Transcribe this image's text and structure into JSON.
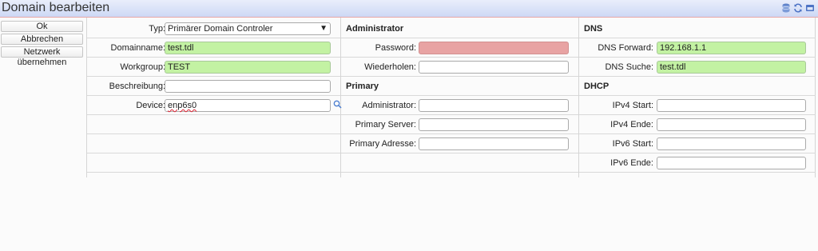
{
  "window": {
    "title": "Domain bearbeiten"
  },
  "toolbar": {
    "buttons": [
      {
        "label": "Ok"
      },
      {
        "label": "Abbrechen"
      },
      {
        "label": "Netzwerk übernehmen"
      }
    ]
  },
  "form": {
    "typ": {
      "label": "Typ:",
      "value": "Primärer Domain Controler"
    },
    "domainname": {
      "label": "Domainname:",
      "value": "test.tdl"
    },
    "workgroup": {
      "label": "Workgroup:",
      "value": "TEST"
    },
    "beschreibung": {
      "label": "Beschreibung:",
      "value": ""
    },
    "device": {
      "label": "Device:",
      "value": "enp6s0"
    }
  },
  "administrator": {
    "heading": "Administrator",
    "password": {
      "label": "Password:",
      "value": ""
    },
    "wiederholen": {
      "label": "Wiederholen:",
      "value": ""
    }
  },
  "primary": {
    "heading": "Primary",
    "administrator": {
      "label": "Administrator:",
      "value": ""
    },
    "server": {
      "label": "Primary Server:",
      "value": ""
    },
    "adresse": {
      "label": "Primary Adresse:",
      "value": ""
    }
  },
  "dns": {
    "heading": "DNS",
    "forward": {
      "label": "DNS Forward:",
      "value": "192.168.1.1"
    },
    "suche": {
      "label": "DNS Suche:",
      "value": "test.tdl"
    }
  },
  "dhcp": {
    "heading": "DHCP",
    "ipv4_start": {
      "label": "IPv4 Start:",
      "value": ""
    },
    "ipv4_ende": {
      "label": "IPv4 Ende:",
      "value": ""
    },
    "ipv6_start": {
      "label": "IPv6 Start:",
      "value": ""
    },
    "ipv6_ende": {
      "label": "IPv6 Ende:",
      "value": ""
    }
  },
  "colors": {
    "valid": "#c3f2a3",
    "invalid": "#e8a3a3",
    "accent": "#cdd8f5"
  }
}
